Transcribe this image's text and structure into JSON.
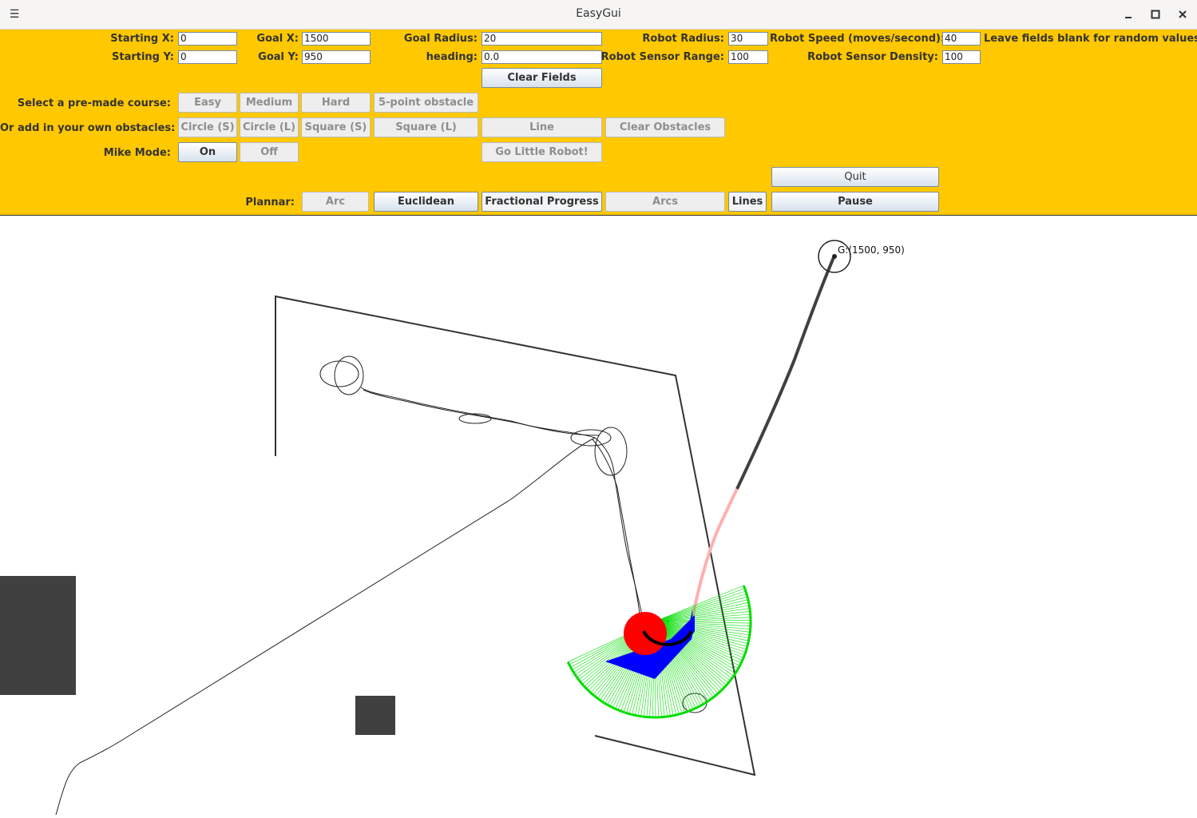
{
  "window": {
    "title": "EasyGui",
    "menu_icon": "hamburger-menu-icon",
    "minimize_icon": "minimize-icon",
    "maximize_icon": "maximize-icon",
    "close_icon": "close-icon"
  },
  "fields": {
    "starting_x": {
      "label": "Starting X:",
      "value": "0"
    },
    "starting_y": {
      "label": "Starting Y:",
      "value": "0"
    },
    "goal_x": {
      "label": "Goal X:",
      "value": "1500"
    },
    "goal_y": {
      "label": "Goal Y:",
      "value": "950"
    },
    "goal_radius": {
      "label": "Goal Radius:",
      "value": "20"
    },
    "heading": {
      "label": "heading:",
      "value": "0.0"
    },
    "robot_radius": {
      "label": "Robot Radius:",
      "value": "30"
    },
    "robot_sensor_range": {
      "label": "Robot Sensor Range:",
      "value": "100"
    },
    "robot_speed": {
      "label": "Robot Speed (moves/second):",
      "value": "40"
    },
    "robot_sensor_density": {
      "label": "Robot Sensor Density:",
      "value": "100"
    },
    "hint": "Leave fields blank for random values!"
  },
  "buttons": {
    "clear_fields": "Clear Fields",
    "course_label": "Select a pre-made course:",
    "easy": "Easy",
    "medium": "Medium",
    "hard": "Hard",
    "five_point": "5-point obstacle",
    "obstacles_label": "Or add in your own obstacles:",
    "circle_s": "Circle (S)",
    "circle_l": "Circle (L)",
    "square_s": "Square (S)",
    "square_l": "Square (L)",
    "line": "Line",
    "clear_obstacles": "Clear Obstacles",
    "mike_mode_label": "Mike Mode:",
    "on": "On",
    "off": "Off",
    "go": "Go Little Robot!",
    "quit": "Quit",
    "planner_label": "Plannar:",
    "arc": "Arc",
    "euclidean": "Euclidean",
    "fractional_progress": "Fractional Progress",
    "arcs": "Arcs",
    "lines": "Lines",
    "pause": "Pause"
  },
  "canvas": {
    "goal_label": "G:(1500, 950)",
    "colors": {
      "obstacle": "#404040",
      "robot_body": "#ff0000",
      "sensor_sweep": "#0000ff",
      "sensor_rays": "#00dd00",
      "planned_path_near": "#ffb0b0",
      "planned_path_far": "#404040"
    }
  }
}
